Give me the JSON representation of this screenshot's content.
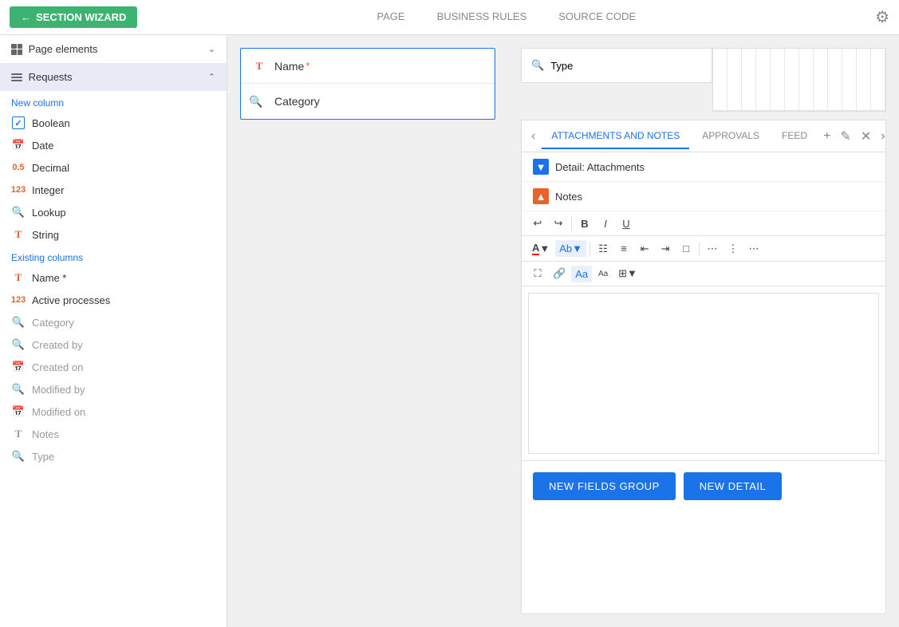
{
  "topnav": {
    "wizard_btn": "SECTION WIZARD",
    "tabs": [
      {
        "id": "page",
        "label": "PAGE",
        "active": true
      },
      {
        "id": "business_rules",
        "label": "BUSINESS RULES",
        "active": false
      },
      {
        "id": "source_code",
        "label": "SOURCE CODE",
        "active": false
      }
    ]
  },
  "sidebar": {
    "page_elements": {
      "label": "Page elements"
    },
    "requests": {
      "label": "Requests"
    },
    "new_column_label": "New column",
    "new_column_items": [
      {
        "id": "boolean",
        "label": "Boolean",
        "icon": "bool"
      },
      {
        "id": "date",
        "label": "Date",
        "icon": "date"
      },
      {
        "id": "decimal",
        "label": "Decimal",
        "icon": "decimal"
      },
      {
        "id": "integer",
        "label": "Integer",
        "icon": "int"
      },
      {
        "id": "lookup",
        "label": "Lookup",
        "icon": "lookup"
      },
      {
        "id": "string",
        "label": "String",
        "icon": "string"
      }
    ],
    "existing_columns_label": "Existing columns",
    "existing_columns_items": [
      {
        "id": "name",
        "label": "Name *",
        "icon": "name"
      },
      {
        "id": "active_processes",
        "label": "Active processes",
        "icon": "active"
      },
      {
        "id": "category",
        "label": "Category",
        "icon": "cat",
        "dimmed": true
      },
      {
        "id": "created_by",
        "label": "Created by",
        "icon": "crby",
        "dimmed": true
      },
      {
        "id": "created_on",
        "label": "Created on",
        "icon": "cron",
        "dimmed": true
      },
      {
        "id": "modified_by",
        "label": "Modified by",
        "icon": "modby",
        "dimmed": true
      },
      {
        "id": "modified_on",
        "label": "Modified on",
        "icon": "modon",
        "dimmed": true
      },
      {
        "id": "notes",
        "label": "Notes",
        "icon": "notes",
        "dimmed": true
      },
      {
        "id": "type",
        "label": "Type",
        "icon": "type",
        "dimmed": true
      }
    ]
  },
  "center": {
    "form_fields": [
      {
        "id": "name",
        "label": "Name",
        "required": true,
        "icon_type": "T"
      },
      {
        "id": "category",
        "label": "Category",
        "required": false,
        "icon_type": "search"
      }
    ]
  },
  "right": {
    "type_field": {
      "label": "Type",
      "icon_type": "search"
    },
    "attachments_tabs": [
      {
        "id": "attachments_notes",
        "label": "ATTACHMENTS AND NOTES",
        "active": true
      },
      {
        "id": "approvals",
        "label": "APPROVALS",
        "active": false
      },
      {
        "id": "feed",
        "label": "FEED",
        "active": false
      }
    ],
    "detail_attachments": {
      "label": "Detail: Attachments"
    },
    "notes_row": {
      "label": "Notes"
    },
    "toolbar": {
      "undo": "↩",
      "redo": "↪",
      "bold": "B",
      "italic": "I",
      "underline": "U",
      "font_color_label": "A",
      "font_bg_label": "Ab",
      "ordered_list": "ol",
      "unordered_list": "ul",
      "indent_dec": "←",
      "indent_inc": "→",
      "expand": "⛶",
      "align_left": "≡l",
      "align_center": "≡c",
      "align_right": "≡r",
      "image": "🖼",
      "link": "🔗",
      "font_size_a": "Aa",
      "font_size_b": "Aa",
      "table": "⊞"
    },
    "bottom_buttons": [
      {
        "id": "new_fields_group",
        "label": "NEW FIELDS GROUP"
      },
      {
        "id": "new_detail",
        "label": "NEW DETAIL"
      }
    ]
  }
}
